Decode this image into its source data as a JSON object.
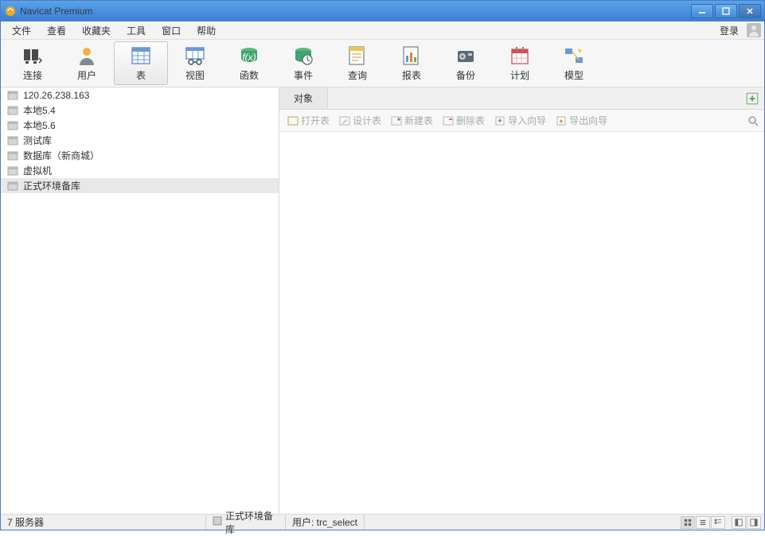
{
  "app": {
    "title": "Navicat Premium"
  },
  "menubar": {
    "items": [
      "文件",
      "查看",
      "收藏夹",
      "工具",
      "窗口",
      "帮助"
    ],
    "login": "登录"
  },
  "toolbar": {
    "items": [
      {
        "label": "连接",
        "icon": "connection-icon"
      },
      {
        "label": "用户",
        "icon": "user-icon"
      },
      {
        "label": "表",
        "icon": "table-icon",
        "active": true
      },
      {
        "label": "视图",
        "icon": "view-icon"
      },
      {
        "label": "函数",
        "icon": "function-icon"
      },
      {
        "label": "事件",
        "icon": "event-icon"
      },
      {
        "label": "查询",
        "icon": "query-icon"
      },
      {
        "label": "报表",
        "icon": "report-icon"
      },
      {
        "label": "备份",
        "icon": "backup-icon"
      },
      {
        "label": "计划",
        "icon": "schedule-icon"
      },
      {
        "label": "模型",
        "icon": "model-icon"
      }
    ]
  },
  "tree": {
    "items": [
      {
        "label": "120.26.238.163"
      },
      {
        "label": "本地5.4"
      },
      {
        "label": "本地5.6"
      },
      {
        "label": "测试库"
      },
      {
        "label": "数据库（新商城）"
      },
      {
        "label": "虚拟机"
      },
      {
        "label": "正式环境备库",
        "selected": true
      }
    ]
  },
  "objects": {
    "tab": "对象",
    "toolbar": [
      "打开表",
      "设计表",
      "新建表",
      "删除表",
      "导入向导",
      "导出向导"
    ]
  },
  "status": {
    "server_count": "7 服务器",
    "connection": "正式环境备库",
    "user": "用户: trc_select"
  }
}
